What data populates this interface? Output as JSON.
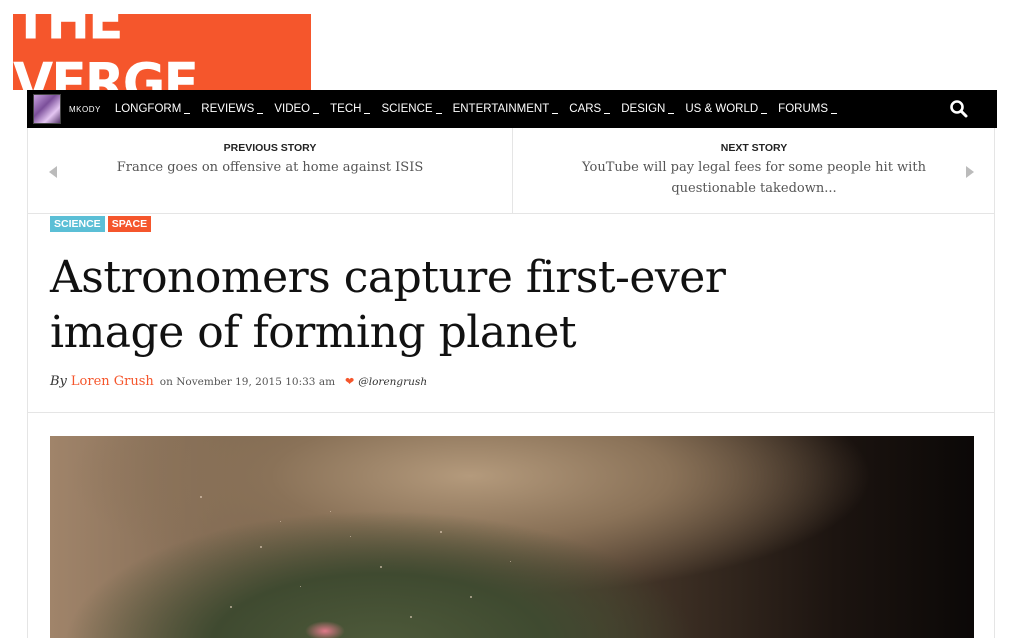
{
  "logo": {
    "text": "THE VERGE"
  },
  "nav": {
    "username": "MKODY",
    "items": [
      {
        "label": "LONGFORM"
      },
      {
        "label": "REVIEWS"
      },
      {
        "label": "VIDEO"
      },
      {
        "label": "TECH"
      },
      {
        "label": "SCIENCE"
      },
      {
        "label": "ENTERTAINMENT"
      },
      {
        "label": "CARS"
      },
      {
        "label": "DESIGN"
      },
      {
        "label": "US & WORLD"
      },
      {
        "label": "FORUMS"
      }
    ],
    "search_icon": "search-icon"
  },
  "story_nav": {
    "previous": {
      "label": "PREVIOUS STORY",
      "title": "France goes on offensive at home against ISIS"
    },
    "next": {
      "label": "NEXT STORY",
      "title": "YouTube will pay legal fees for some people hit with questionable takedown..."
    }
  },
  "article": {
    "tags": [
      "SCIENCE",
      "SPACE"
    ],
    "headline": "Astronomers capture first-ever image of forming planet",
    "byline": {
      "by": "By",
      "author": "Loren Grush",
      "date": "on November 19, 2015 10:33 am",
      "twitter_icon": "twitter-icon",
      "handle": "@lorengrush"
    }
  },
  "colors": {
    "brand": "#f5562c",
    "science_tag": "#5bbfd6",
    "nav_bg": "#000000"
  }
}
